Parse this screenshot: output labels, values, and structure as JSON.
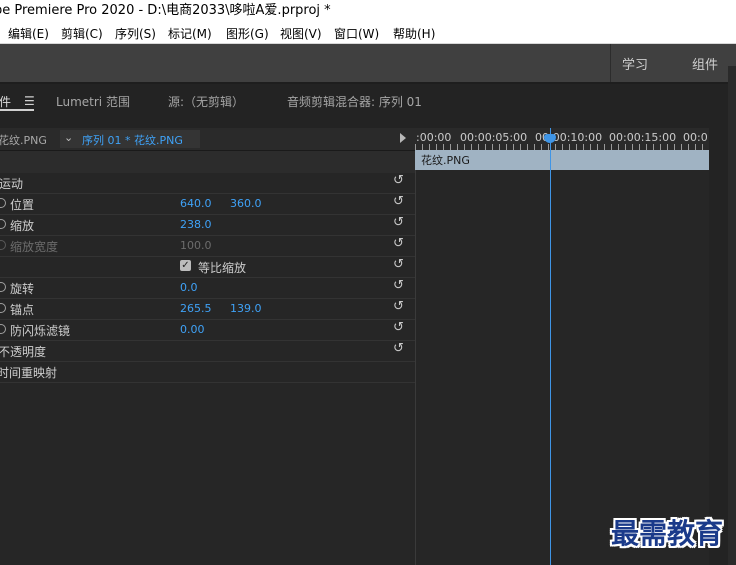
{
  "window": {
    "title": "be Premiere Pro 2020 - D:\\电商2033\\哆啦A爱.prproj *"
  },
  "menu": {
    "items": [
      "编辑(E)",
      "剪辑(C)",
      "序列(S)",
      "标记(M)",
      "图形(G)",
      "视图(V)",
      "窗口(W)",
      "帮助(H)"
    ]
  },
  "workspaces": {
    "learn": "学习",
    "assemble": "组件"
  },
  "panel_tabs": {
    "effect_controls": "件",
    "lumetri": "Lumetri 范围",
    "source": "源:（无剪辑）",
    "audio_mixer": "音频剪辑混合器: 序列 01"
  },
  "source_bar": {
    "clip": "花纹.PNG",
    "sequence_clip": "序列 01 * 花纹.PNG"
  },
  "properties": {
    "motion": "运动",
    "position": {
      "label": "位置",
      "x": "640.0",
      "y": "360.0"
    },
    "scale": {
      "label": "缩放",
      "value": "238.0"
    },
    "scale_width": {
      "label": "缩放宽度",
      "value": "100.0"
    },
    "uniform_scale": {
      "label": "等比缩放",
      "checked": true
    },
    "rotation": {
      "label": "旋转",
      "value": "0.0"
    },
    "anchor": {
      "label": "锚点",
      "x": "265.5",
      "y": "139.0"
    },
    "anti_flicker": {
      "label": "防闪烁滤镜",
      "value": "0.00"
    },
    "opacity": "不透明度",
    "time_remap": "时间重映射"
  },
  "timeline": {
    "timecodes": [
      ":00:00",
      "00:00:05:00",
      "00:00:10:00",
      "00:00:15:00",
      "00:0"
    ],
    "clip_name": "花纹.PNG"
  },
  "watermark": "最需教育"
}
